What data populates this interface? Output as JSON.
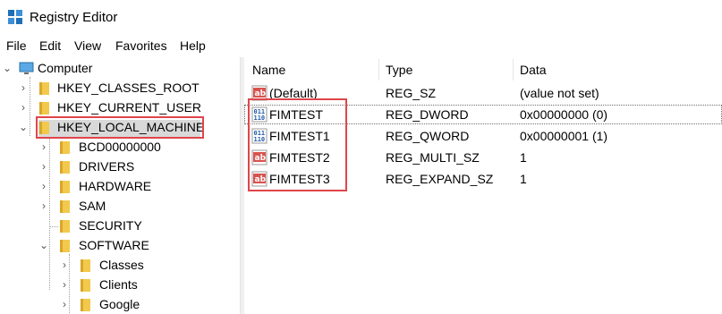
{
  "window": {
    "title": "Registry Editor"
  },
  "menu": [
    "File",
    "Edit",
    "View",
    "Favorites",
    "Help"
  ],
  "tree": {
    "root": "Computer",
    "hives": [
      "HKEY_CLASSES_ROOT",
      "HKEY_CURRENT_USER",
      "HKEY_LOCAL_MACHINE"
    ],
    "hklm_children": [
      "BCD00000000",
      "DRIVERS",
      "HARDWARE",
      "SAM",
      "SECURITY",
      "SOFTWARE"
    ],
    "software_children": [
      "Classes",
      "Clients",
      "Google"
    ]
  },
  "columns": {
    "name": "Name",
    "type": "Type",
    "data": "Data"
  },
  "values": [
    {
      "name": "(Default)",
      "type": "REG_SZ",
      "data": "(value not set)",
      "icon": "string-value-icon"
    },
    {
      "name": "FIMTEST",
      "type": "REG_DWORD",
      "data": "0x00000000 (0)",
      "icon": "binary-value-icon"
    },
    {
      "name": "FIMTEST1",
      "type": "REG_QWORD",
      "data": "0x00000001 (1)",
      "icon": "binary-value-icon"
    },
    {
      "name": "FIMTEST2",
      "type": "REG_MULTI_SZ",
      "data": "1",
      "icon": "string-value-icon"
    },
    {
      "name": "FIMTEST3",
      "type": "REG_EXPAND_SZ",
      "data": "1",
      "icon": "string-value-icon"
    }
  ],
  "colors": {
    "annotation_red": "#e0454a",
    "folder_yellow": "#f2c94c",
    "selection_gray": "#d9d9d9"
  }
}
